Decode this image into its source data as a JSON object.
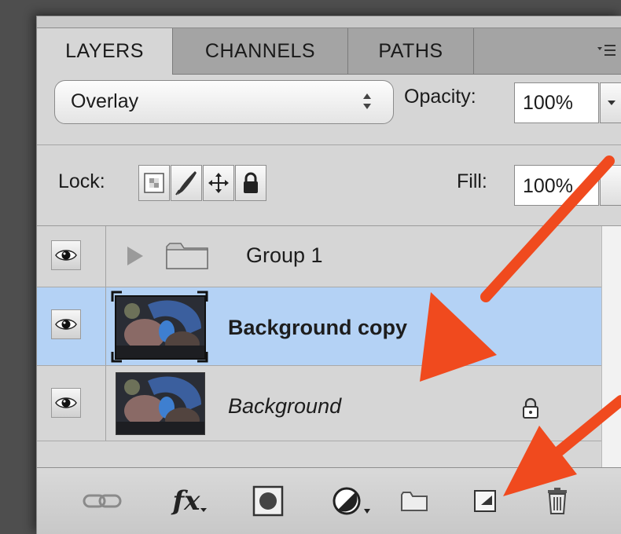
{
  "tabs": [
    {
      "label": "LAYERS",
      "active": true
    },
    {
      "label": "CHANNELS",
      "active": false
    },
    {
      "label": "PATHS",
      "active": false
    }
  ],
  "panel_menu_icon": "panel-menu-icon",
  "blend_mode": {
    "value": "Overlay",
    "arrows": "up-down-chevron-icon"
  },
  "opacity": {
    "label": "Opacity:",
    "value": "100%"
  },
  "lock": {
    "label": "Lock:",
    "buttons": [
      "lock-transparency-icon",
      "lock-image-pixels-icon",
      "lock-position-icon",
      "lock-all-icon"
    ]
  },
  "fill": {
    "label": "Fill:",
    "value": "100%"
  },
  "layers": [
    {
      "name": "Group 1",
      "type": "group",
      "visible": true,
      "selected": false
    },
    {
      "name": "Background copy",
      "type": "image",
      "visible": true,
      "selected": true
    },
    {
      "name": "Background",
      "type": "image",
      "visible": true,
      "selected": false,
      "locked": true
    }
  ],
  "bottom_icons": [
    "link-layers-icon",
    "fx-icon",
    "layer-mask-icon",
    "adjustment-layer-icon",
    "new-group-icon",
    "new-layer-icon",
    "delete-icon"
  ],
  "fx_label": "fx",
  "colors": {
    "selection": "#b4d2f5",
    "arrow": "#f04a1e",
    "panel": "#d6d6d6"
  }
}
